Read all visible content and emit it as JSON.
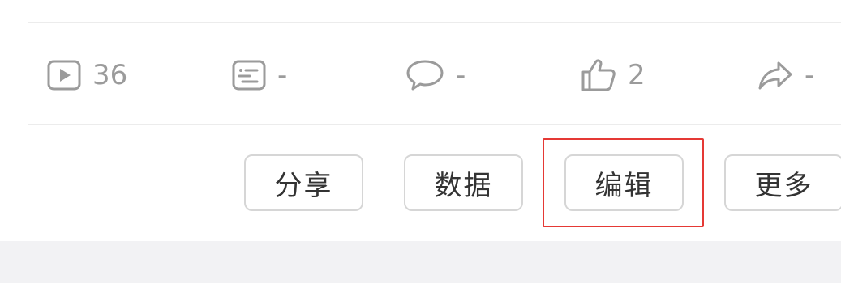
{
  "stats": {
    "plays": {
      "icon": "play-icon",
      "value": "36"
    },
    "danmaku": {
      "icon": "danmaku-icon",
      "value": "-"
    },
    "comments": {
      "icon": "comment-icon",
      "value": "-"
    },
    "likes": {
      "icon": "thumbs-up-icon",
      "value": "2"
    },
    "shares": {
      "icon": "share-arrow-icon",
      "value": "-"
    }
  },
  "actions": {
    "share_label": "分享",
    "data_label": "数据",
    "edit_label": "编辑",
    "more_label": "更多"
  },
  "highlight": {
    "target": "edit-button",
    "color": "#e53935"
  }
}
